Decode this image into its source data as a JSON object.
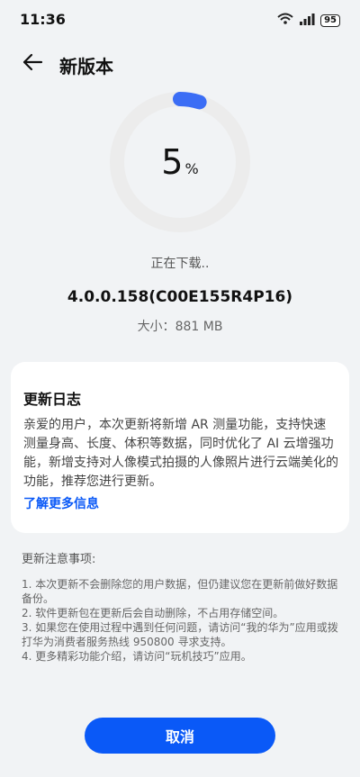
{
  "status_bar": {
    "time": "11:36",
    "battery": "95"
  },
  "header": {
    "title": "新版本"
  },
  "progress": {
    "value": 5,
    "label": "5",
    "unit": "%"
  },
  "download_status": "正在下载..",
  "version": "4.0.0.158(C00E155R4P16)",
  "size": {
    "label": "大小：",
    "value": "881 MB"
  },
  "changelog": {
    "title": "更新日志",
    "body": "亲爱的用户，本次更新将新增 AR 测量功能，支持快速测量身高、长度、体积等数据，同时优化了 AI 云增强功能，新增支持对人像模式拍摄的人像照片进行云端美化的功能，推荐您进行更新。",
    "more_link": "了解更多信息"
  },
  "notes": {
    "title": "更新注意事项:",
    "items": [
      "1. 本次更新不会删除您的用户数据，但仍建议您在更新前做好数据备份。",
      "2. 软件更新包在更新后会自动删除，不占用存储空间。",
      "3. 如果您在使用过程中遇到任何问题，请访问“我的华为”应用或拨打华为消费者服务热线 950800 寻求支持。",
      "4. 更多精彩功能介绍，请访问“玩机技巧”应用。"
    ]
  },
  "cancel_label": "取消",
  "colors": {
    "accent": "#0a59f7",
    "ring_track": "#ececec",
    "ring_fill": "#3b6df5"
  },
  "icons": {
    "back": "back-arrow-icon",
    "wifi": "wifi-icon",
    "signal": "signal-icon"
  }
}
